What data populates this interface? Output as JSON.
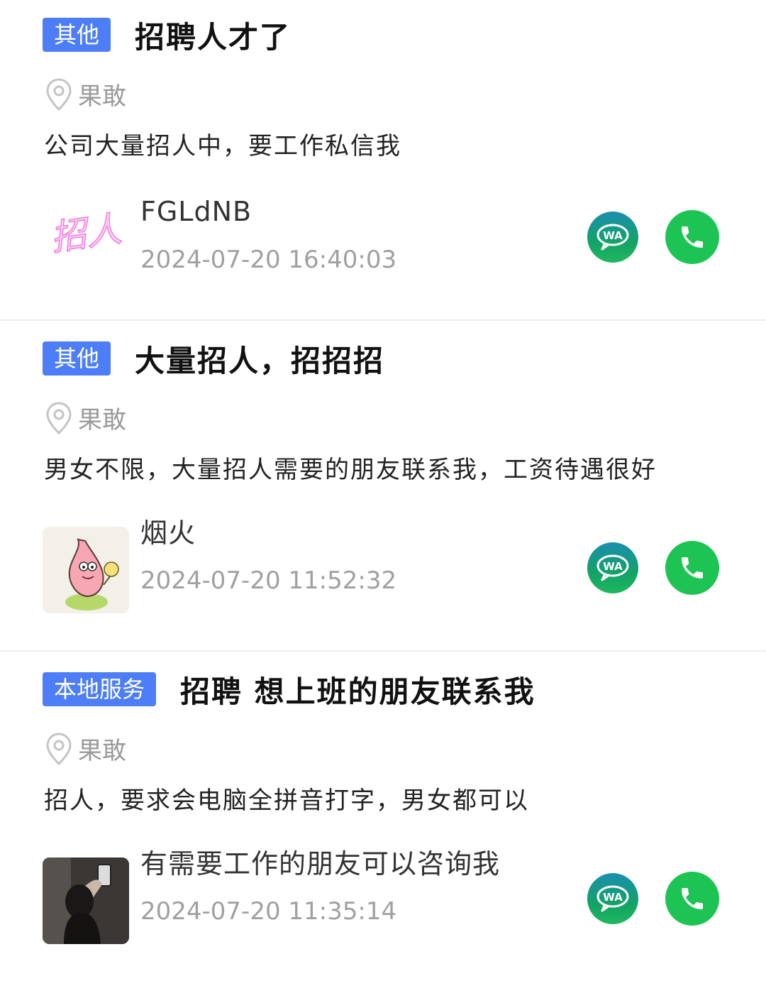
{
  "posts": [
    {
      "tag": "其他",
      "title": "招聘人才了",
      "location": "果敢",
      "description": "公司大量招人中，要工作私信我",
      "avatar_text": "招人",
      "username": "FGLdNB",
      "timestamp": "2024-07-20 16:40:03"
    },
    {
      "tag": "其他",
      "title": "大量招人，招招招",
      "location": "果敢",
      "description": "男女不限，大量招人需要的朋友联系我，工资待遇很好",
      "avatar_text": "",
      "username": "烟火",
      "timestamp": "2024-07-20 11:52:32"
    },
    {
      "tag": "本地服务",
      "title": "招聘 想上班的朋友联系我",
      "location": "果敢",
      "description": "招人，要求会电脑全拼音打字，男女都可以",
      "avatar_text": "",
      "username": "有需要工作的朋友可以咨询我",
      "timestamp": "2024-07-20 11:35:14"
    }
  ],
  "icons": {
    "location": "location-pin-icon",
    "whatsapp": "whatsapp-icon",
    "phone": "phone-icon"
  },
  "colors": {
    "tag_bg": "#4d7ef7",
    "phone_green": "#1ec453",
    "whatsapp_gradient": [
      "#1b8fb0",
      "#1eb85d"
    ]
  }
}
